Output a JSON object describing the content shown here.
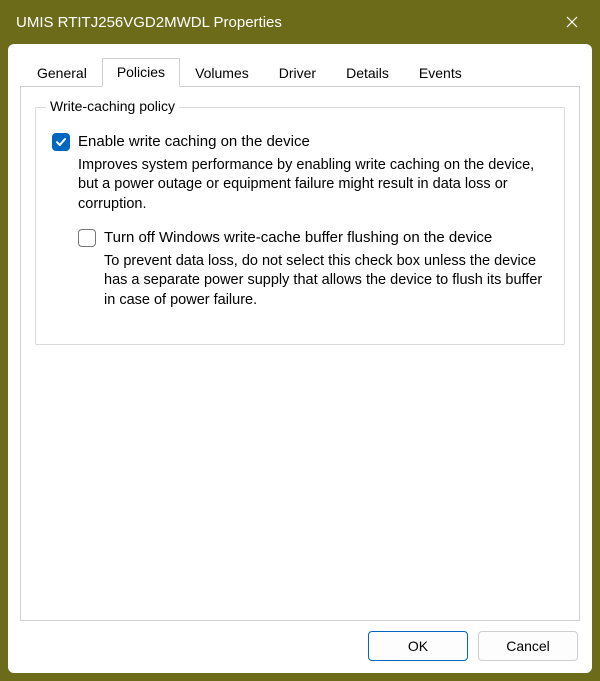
{
  "window": {
    "title": "UMIS RTITJ256VGD2MWDL Properties"
  },
  "tabs": {
    "items": [
      {
        "label": "General"
      },
      {
        "label": "Policies"
      },
      {
        "label": "Volumes"
      },
      {
        "label": "Driver"
      },
      {
        "label": "Details"
      },
      {
        "label": "Events"
      }
    ],
    "active_index": 1
  },
  "group": {
    "title": "Write-caching policy",
    "option1": {
      "checked": true,
      "label": "Enable write caching on the device",
      "description": "Improves system performance by enabling write caching on the device, but a power outage or equipment failure might result in data loss or corruption."
    },
    "option2": {
      "checked": false,
      "label": "Turn off Windows write-cache buffer flushing on the device",
      "description": "To prevent data loss, do not select this check box unless the device has a separate power supply that allows the device to flush its buffer in case of power failure."
    }
  },
  "buttons": {
    "ok": "OK",
    "cancel": "Cancel"
  }
}
